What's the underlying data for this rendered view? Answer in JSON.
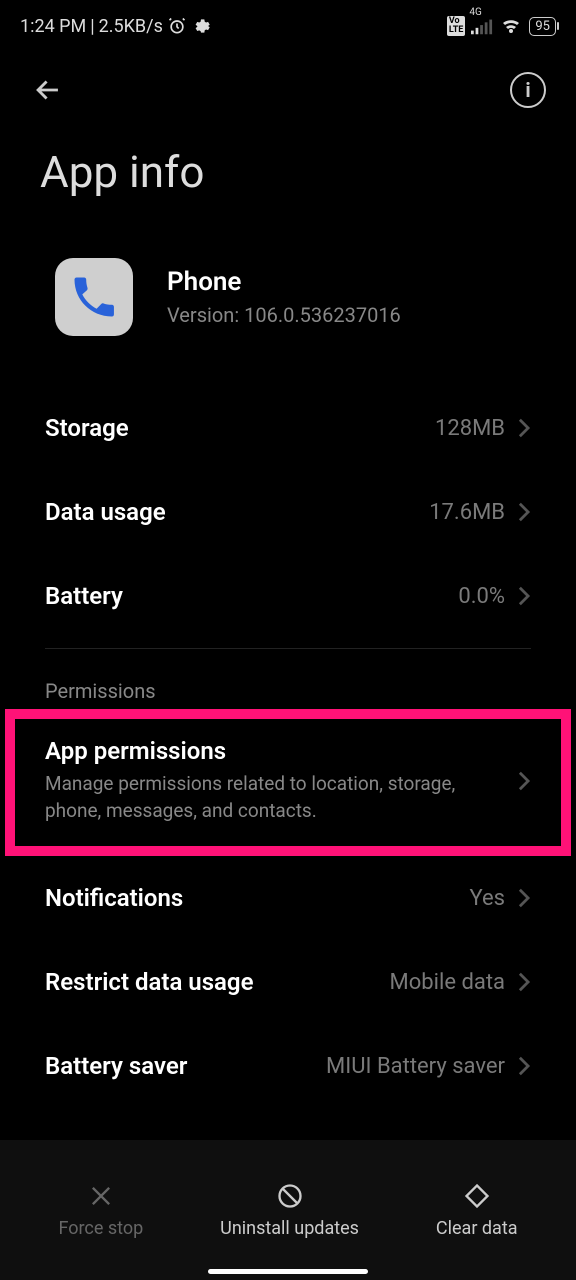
{
  "status": {
    "time": "1:24 PM",
    "separator": " | ",
    "speed": "2.5KB/s",
    "volte": "Vo LTE",
    "network": "4G",
    "battery": "95"
  },
  "pageTitle": "App info",
  "app": {
    "name": "Phone",
    "version": "Version: 106.0.536237016"
  },
  "rows": {
    "storage": {
      "label": "Storage",
      "value": "128MB"
    },
    "dataUsage": {
      "label": "Data usage",
      "value": "17.6MB"
    },
    "battery": {
      "label": "Battery",
      "value": "0.0%"
    },
    "permissionsHeader": "Permissions",
    "appPermissions": {
      "label": "App permissions",
      "desc": "Manage permissions related to location, storage, phone, messages, and contacts."
    },
    "notifications": {
      "label": "Notifications",
      "value": "Yes"
    },
    "restrictData": {
      "label": "Restrict data usage",
      "value": "Mobile data"
    },
    "batterySaver": {
      "label": "Battery saver",
      "value": "MIUI Battery saver"
    }
  },
  "bottom": {
    "forceStop": "Force stop",
    "uninstallUpdates": "Uninstall updates",
    "clearData": "Clear data"
  }
}
